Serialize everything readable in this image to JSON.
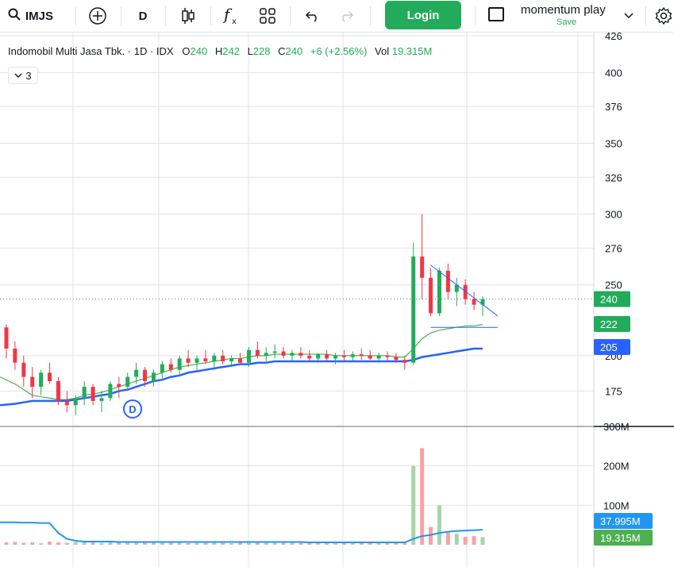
{
  "toolbar": {
    "symbol": "IMJS",
    "interval": "D",
    "login_label": "Login",
    "layout_name": "momentum play",
    "save_label": "Save",
    "icons": [
      "search-icon",
      "add-symbol-icon",
      "candles-icon",
      "indicators-icon",
      "layout-grid-icon",
      "undo-icon",
      "redo-icon",
      "chevron-down-icon",
      "settings-icon"
    ]
  },
  "legend": {
    "title": "Indomobil Multi Jasa Tbk. · 1D · IDX",
    "o_label": "O",
    "o_value": "240",
    "h_label": "H",
    "h_value": "242",
    "l_label": "L",
    "l_value": "228",
    "c_label": "C",
    "c_value": "240",
    "change": "+6 (+2.56%)",
    "vol_label": "Vol",
    "vol_value": "19.315M",
    "collapse_count": "3"
  },
  "price_axis": {
    "ticks": [
      "426",
      "400",
      "376",
      "350",
      "326",
      "300",
      "276",
      "250",
      "200",
      "175"
    ],
    "tags": {
      "last": {
        "label": "240",
        "color": "#22ab5a"
      },
      "ma_fast": {
        "label": "222",
        "color": "#22ab5a"
      },
      "ma_slow": {
        "label": "205",
        "color": "#2962ff"
      }
    }
  },
  "volume_axis": {
    "ticks": [
      "300M",
      "200M",
      "100M"
    ],
    "tags": {
      "vol_ma": {
        "label": "37.995M",
        "color": "#2196f3"
      },
      "vol": {
        "label": "19.315M",
        "color": "#4caf50"
      }
    }
  },
  "marker": {
    "label": "D",
    "color": "#2962ff"
  },
  "colors": {
    "up": "#22ab5a",
    "down": "#f23645",
    "ma_fast": "#4caf50",
    "ma_slow": "#2962ff",
    "vol_up": "#a5d6a7",
    "vol_down": "#faa1a4",
    "grid": "#e0e3eb",
    "last_line": "#22ab5a"
  },
  "chart_data": {
    "type": "candlestick",
    "price_range": [
      150,
      426
    ],
    "volume_range": [
      0,
      300000000
    ],
    "last_price": 240,
    "candles": [
      [
        220,
        222,
        198,
        205
      ],
      [
        205,
        210,
        190,
        195
      ],
      [
        195,
        200,
        178,
        185
      ],
      [
        185,
        192,
        170,
        178
      ],
      [
        178,
        190,
        172,
        188
      ],
      [
        188,
        195,
        180,
        182
      ],
      [
        182,
        185,
        165,
        168
      ],
      [
        168,
        175,
        160,
        165
      ],
      [
        165,
        172,
        158,
        170
      ],
      [
        170,
        182,
        165,
        178
      ],
      [
        178,
        180,
        165,
        168
      ],
      [
        168,
        175,
        160,
        170
      ],
      [
        170,
        182,
        168,
        180
      ],
      [
        180,
        185,
        170,
        178
      ],
      [
        178,
        188,
        175,
        185
      ],
      [
        185,
        195,
        180,
        190
      ],
      [
        190,
        192,
        178,
        182
      ],
      [
        182,
        190,
        178,
        188
      ],
      [
        188,
        196,
        184,
        194
      ],
      [
        194,
        198,
        188,
        190
      ],
      [
        190,
        200,
        186,
        198
      ],
      [
        198,
        204,
        192,
        195
      ],
      [
        195,
        200,
        190,
        198
      ],
      [
        198,
        204,
        194,
        196
      ],
      [
        196,
        202,
        190,
        200
      ],
      [
        200,
        204,
        194,
        196
      ],
      [
        196,
        200,
        192,
        198
      ],
      [
        198,
        202,
        194,
        195
      ],
      [
        195,
        206,
        192,
        204
      ],
      [
        204,
        210,
        198,
        200
      ],
      [
        200,
        206,
        196,
        202
      ],
      [
        202,
        208,
        198,
        203
      ],
      [
        203,
        206,
        198,
        200
      ],
      [
        200,
        204,
        196,
        202
      ],
      [
        202,
        206,
        198,
        200
      ],
      [
        200,
        204,
        196,
        198
      ],
      [
        198,
        202,
        195,
        201
      ],
      [
        201,
        204,
        196,
        198
      ],
      [
        198,
        202,
        194,
        200
      ],
      [
        200,
        204,
        196,
        199
      ],
      [
        199,
        203,
        196,
        201
      ],
      [
        201,
        205,
        197,
        200
      ],
      [
        200,
        204,
        197,
        198
      ],
      [
        198,
        202,
        195,
        200
      ],
      [
        200,
        203,
        196,
        199
      ],
      [
        199,
        202,
        195,
        197
      ],
      [
        197,
        200,
        190,
        195
      ],
      [
        195,
        280,
        194,
        270
      ],
      [
        270,
        300,
        240,
        255
      ],
      [
        255,
        262,
        228,
        230
      ],
      [
        230,
        262,
        228,
        260
      ],
      [
        260,
        265,
        240,
        245
      ],
      [
        245,
        255,
        235,
        250
      ],
      [
        250,
        254,
        236,
        240
      ],
      [
        240,
        245,
        232,
        236
      ],
      [
        236,
        242,
        228,
        240
      ]
    ],
    "ma_fast": [
      185,
      180,
      176,
      172,
      171,
      170,
      169,
      169,
      170,
      172,
      173,
      174,
      176,
      178,
      180,
      182,
      184,
      186,
      188,
      190,
      192,
      193,
      194,
      195,
      196,
      197,
      198,
      198,
      199,
      200,
      200,
      201,
      201,
      201,
      201,
      201,
      201,
      201,
      200,
      200,
      200,
      200,
      200,
      200,
      200,
      199,
      199,
      205,
      212,
      216,
      218,
      219,
      220,
      221,
      221,
      222
    ],
    "ma_slow": [
      165,
      166,
      167,
      168,
      168,
      168,
      168,
      168,
      169,
      170,
      171,
      172,
      173,
      175,
      176,
      178,
      180,
      182,
      183,
      185,
      186,
      188,
      189,
      190,
      191,
      192,
      193,
      194,
      194,
      195,
      195,
      196,
      196,
      196,
      196,
      196,
      196,
      196,
      196,
      196,
      196,
      196,
      196,
      196,
      196,
      196,
      196,
      197,
      199,
      200,
      201,
      202,
      203,
      204,
      205,
      205
    ],
    "volumes": [
      6,
      7,
      5,
      6,
      4,
      8,
      6,
      5,
      7,
      9,
      6,
      5,
      7,
      6,
      5,
      6,
      8,
      9,
      7,
      5,
      6,
      4,
      6,
      7,
      5,
      6,
      4,
      5,
      6,
      7,
      5,
      6,
      9,
      5,
      6,
      4,
      6,
      5,
      7,
      5,
      4,
      6,
      5,
      4,
      6,
      5,
      7,
      200,
      245,
      45,
      100,
      35,
      28,
      20,
      22,
      19.3
    ],
    "volume_ma": [
      57,
      57,
      56,
      56,
      55,
      55,
      30,
      15,
      10,
      8,
      8,
      8,
      8,
      7,
      7,
      7,
      7,
      7,
      7,
      7,
      7,
      7,
      7,
      7,
      7,
      7,
      7,
      7,
      7,
      7,
      7,
      7,
      7,
      7,
      7,
      6,
      6,
      6,
      6,
      6,
      6,
      6,
      6,
      6,
      6,
      6,
      6,
      15,
      22,
      25,
      30,
      33,
      35,
      36,
      37,
      38
    ],
    "triangle": {
      "apex_high": 264,
      "apex_low": 220,
      "end_price": 228
    },
    "volume_scale_note": "millions"
  }
}
